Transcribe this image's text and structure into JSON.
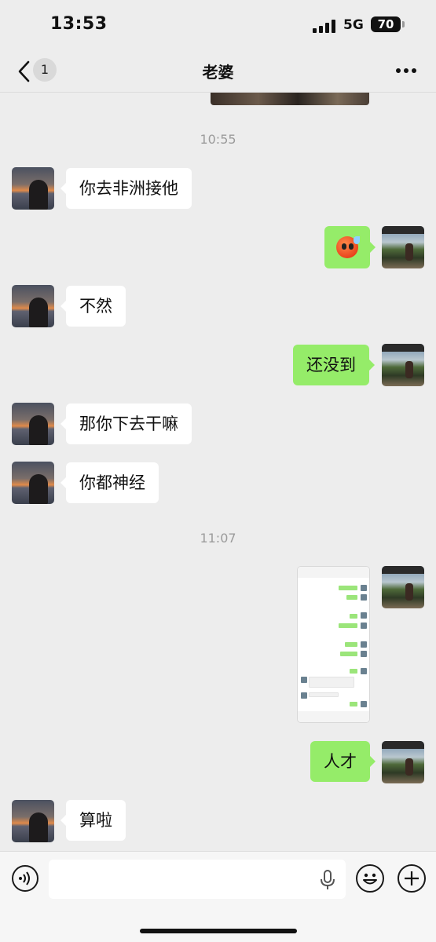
{
  "status_bar": {
    "time": "13:53",
    "network": "5G",
    "battery": "70"
  },
  "nav": {
    "unread_count": "1",
    "title": "老婆",
    "icons": [
      "chevron-left-icon",
      "more-icon"
    ]
  },
  "messages": [
    {
      "type": "timestamp",
      "text": "10:55"
    },
    {
      "type": "text",
      "from": "wife",
      "text": "你去非洲接他"
    },
    {
      "type": "emoji",
      "from": "me",
      "icon": "hot-sweat-face-emoji"
    },
    {
      "type": "text",
      "from": "wife",
      "text": "不然"
    },
    {
      "type": "text",
      "from": "me",
      "text": "还没到"
    },
    {
      "type": "text",
      "from": "wife",
      "text": "那你下去干嘛"
    },
    {
      "type": "text",
      "from": "wife",
      "text": "你都神经"
    },
    {
      "type": "timestamp",
      "text": "11:07"
    },
    {
      "type": "image",
      "from": "me",
      "description": "chat-screenshot-thumbnail"
    },
    {
      "type": "text",
      "from": "me",
      "text": "人才"
    },
    {
      "type": "text",
      "from": "wife",
      "text": "算啦"
    }
  ],
  "colors": {
    "background": "#ededed",
    "my_bubble": "#95ec69",
    "their_bubble": "#ffffff",
    "timestamp": "#9b9b9b"
  },
  "input_bar": {
    "placeholder": "",
    "icons": [
      "voice-icon",
      "mic-icon",
      "emoji-icon",
      "plus-icon"
    ]
  }
}
